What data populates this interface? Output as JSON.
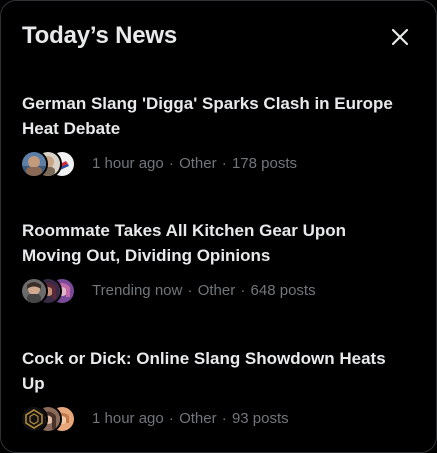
{
  "header": {
    "title": "Today’s News",
    "close_icon": "close-icon"
  },
  "news": [
    {
      "headline": "German Slang 'Digga' Sparks Clash in Europe Heat Debate",
      "time": "1 hour ago",
      "category": "Other",
      "posts": "178 posts",
      "separator": "·",
      "avatars": [
        "avatar-photo-1",
        "avatar-photo-2",
        "avatar-photo-3"
      ]
    },
    {
      "headline": "Roommate Takes All Kitchen Gear Upon Moving Out, Dividing Opinions",
      "time": "Trending now",
      "category": "Other",
      "posts": "648 posts",
      "separator": "·",
      "avatars": [
        "avatar-photo-1",
        "avatar-photo-2",
        "avatar-photo-3"
      ]
    },
    {
      "headline": "Cock or Dick: Online Slang Showdown Heats Up",
      "time": "1 hour ago",
      "category": "Other",
      "posts": "93 posts",
      "separator": "·",
      "avatars": [
        "avatar-photo-1",
        "avatar-photo-2",
        "avatar-photo-3"
      ]
    }
  ],
  "colors": {
    "background": "#000000",
    "border": "#2f3336",
    "primary_text": "#e7e9ea",
    "secondary_text": "#71767b"
  }
}
